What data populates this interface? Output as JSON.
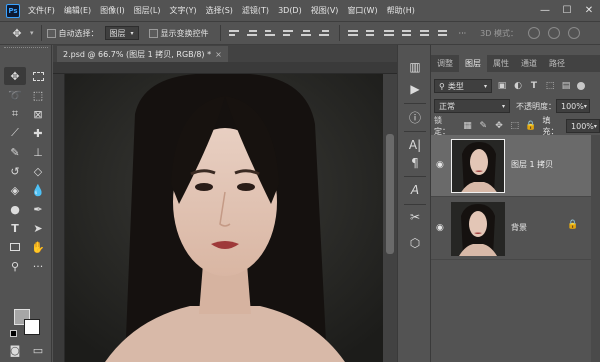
{
  "menubar": {
    "logo": "Ps",
    "items": [
      "文件(F)",
      "编辑(E)",
      "图像(I)",
      "图层(L)",
      "文字(Y)",
      "选择(S)",
      "滤镜(T)",
      "3D(D)",
      "视图(V)",
      "窗口(W)",
      "帮助(H)"
    ],
    "window_controls": [
      "—",
      "☐",
      "✕"
    ]
  },
  "optionsbar": {
    "tool_icon": "move-icon",
    "auto_select_label": "自动选择：",
    "auto_select_value": "图层",
    "show_transform_label": "显示变换控件",
    "mode3d_label": "3D 模式："
  },
  "document": {
    "tab_title": "2.psd @ 66.7% (图层 1 拷贝, RGB/8) *",
    "tab_close": "×"
  },
  "layers_panel": {
    "tabs": [
      "调整",
      "图层",
      "属性",
      "通道",
      "路径"
    ],
    "active_tab": "图层",
    "kind_filter": "类型",
    "blend_mode": "正常",
    "opacity_label": "不透明度：",
    "opacity_value": "100%",
    "lock_label": "锁定：",
    "fill_label": "填充：",
    "fill_value": "100%",
    "layers": [
      {
        "name": "图层 1 拷贝",
        "selected": true,
        "locked": false
      },
      {
        "name": "背景",
        "selected": false,
        "locked": true
      }
    ]
  },
  "colors": {
    "ui_bg": "#535353",
    "foreground": "#a6a6a6",
    "background": "#ffffff",
    "accent": "#3aa3ff"
  }
}
